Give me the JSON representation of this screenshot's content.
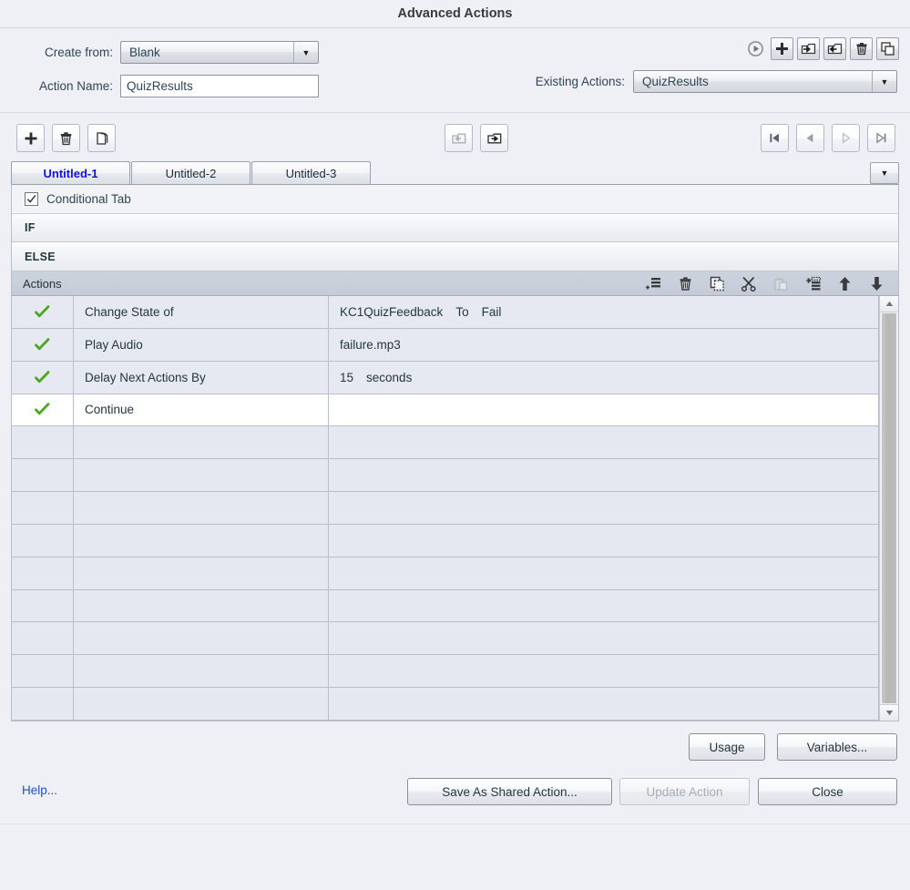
{
  "window": {
    "title": "Advanced Actions"
  },
  "form": {
    "create_from_label": "Create from:",
    "create_from_value": "Blank",
    "action_name_label": "Action Name:",
    "action_name_value": "QuizResults",
    "existing_actions_label": "Existing Actions:",
    "existing_actions_value": "QuizResults"
  },
  "top_toolbar": [
    {
      "name": "preview-action",
      "icon": "play-circle-icon",
      "enabled": false
    },
    {
      "name": "add-action",
      "icon": "plus-icon",
      "enabled": true
    },
    {
      "name": "import-action",
      "icon": "import-folder-icon",
      "enabled": true
    },
    {
      "name": "export-action",
      "icon": "export-folder-icon",
      "enabled": true
    },
    {
      "name": "delete-action",
      "icon": "trash-icon",
      "enabled": true
    },
    {
      "name": "duplicate-action",
      "icon": "duplicate-icon",
      "enabled": true
    }
  ],
  "tab_toolbar": {
    "left": [
      {
        "name": "add-tab",
        "icon": "plus-icon"
      },
      {
        "name": "delete-tab",
        "icon": "trash-icon"
      },
      {
        "name": "duplicate-tab",
        "icon": "copy-pages-icon"
      }
    ],
    "middle": [
      {
        "name": "move-tab-left",
        "icon": "folder-left-arrow-icon",
        "enabled": false
      },
      {
        "name": "move-tab-right",
        "icon": "folder-right-arrow-icon",
        "enabled": true
      }
    ],
    "right": [
      {
        "name": "first-tab",
        "icon": "first-page-icon",
        "enabled": true
      },
      {
        "name": "previous-tab",
        "icon": "previous-page-icon",
        "enabled": true
      },
      {
        "name": "next-tab",
        "icon": "next-page-icon",
        "enabled": false
      },
      {
        "name": "last-tab",
        "icon": "last-page-icon",
        "enabled": false
      }
    ]
  },
  "tabs": {
    "items": [
      {
        "label": "Untitled-1",
        "active": true
      },
      {
        "label": "Untitled-2",
        "active": false
      },
      {
        "label": "Untitled-3",
        "active": false
      }
    ],
    "overflow_icon": "chevron-down-icon"
  },
  "conditional": {
    "checkbox_label": "Conditional Tab",
    "checked": true,
    "if_label": "IF",
    "else_label": "ELSE"
  },
  "actions_panel": {
    "header_label": "Actions",
    "tools": [
      {
        "name": "add-action-row",
        "icon": "add-list-icon",
        "enabled": true
      },
      {
        "name": "delete-action-row",
        "icon": "trash-icon",
        "enabled": true
      },
      {
        "name": "copy-action-row",
        "icon": "copy-icon",
        "enabled": true
      },
      {
        "name": "cut-action-row",
        "icon": "scissors-icon",
        "enabled": true
      },
      {
        "name": "paste-action-row",
        "icon": "paste-icon",
        "enabled": false
      },
      {
        "name": "insert-action-row",
        "icon": "insert-list-icon",
        "enabled": true
      },
      {
        "name": "move-action-up",
        "icon": "arrow-up-icon",
        "enabled": true
      },
      {
        "name": "move-action-down",
        "icon": "arrow-down-icon",
        "enabled": true
      }
    ]
  },
  "actions_table": {
    "rows": [
      {
        "enabled": true,
        "action": "Change State of",
        "args": [
          "KC1QuizFeedback",
          "To",
          "Fail"
        ],
        "selected": false
      },
      {
        "enabled": true,
        "action": "Play Audio",
        "args": [
          "failure.mp3"
        ],
        "selected": false
      },
      {
        "enabled": true,
        "action": "Delay Next Actions By",
        "args": [
          "15",
          "seconds"
        ],
        "selected": false
      },
      {
        "enabled": true,
        "action": "Continue",
        "args": [],
        "selected": true
      }
    ],
    "empty_row_count": 9
  },
  "scrollbar": {
    "up_icon": "triangle-up-icon",
    "down_icon": "triangle-down-icon"
  },
  "footer": {
    "help_label": "Help...",
    "usage_label": "Usage",
    "variables_label": "Variables...",
    "save_shared_label": "Save As Shared Action...",
    "update_label": "Update Action",
    "update_enabled": false,
    "close_label": "Close"
  },
  "colors": {
    "window_bg": "#eef0f5",
    "active_tab_text": "#1112e8",
    "link": "#1a4fe0",
    "check_green": "#4aa81e",
    "table_row_bg": "#e6e9f1",
    "selected_row_bg": "#ffffff",
    "actions_header_bg": "#c8cfda"
  }
}
